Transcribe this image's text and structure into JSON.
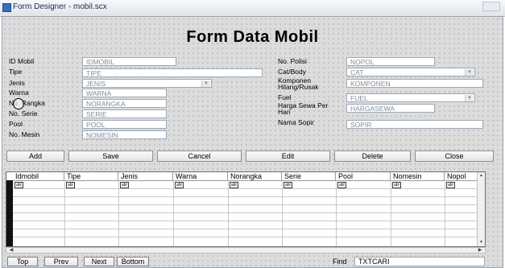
{
  "window": {
    "title": "Form Designer - mobil.scx"
  },
  "heading": "Form Data Mobil",
  "left_fields": [
    {
      "label": "ID Mobil",
      "value": "IDMOBIL",
      "kind": "text"
    },
    {
      "label": "Tipe",
      "value": "TIPE",
      "kind": "text"
    },
    {
      "label": "Jenis",
      "value": "JENIS",
      "kind": "combo"
    },
    {
      "label": "Warna",
      "value": "WARNA",
      "kind": "text"
    },
    {
      "label": "No. Rangka",
      "value": "NORANGKA",
      "kind": "text"
    },
    {
      "label": "No. Serie",
      "value": "SERIE",
      "kind": "text"
    },
    {
      "label": "Pool",
      "value": "POOL",
      "kind": "text"
    },
    {
      "label": "No. Mesin",
      "value": "NOMESIN",
      "kind": "text"
    }
  ],
  "right_fields": [
    {
      "label": "No. Polisi",
      "value": "NOPOL",
      "kind": "text"
    },
    {
      "label": "Cat/Body",
      "value": "CAT",
      "kind": "combo"
    },
    {
      "label": "Komponen Hilang/Rusak",
      "value": "KOMPONEN",
      "kind": "text"
    },
    {
      "label": "Fuel",
      "value": "FUEL",
      "kind": "combo"
    },
    {
      "label": "Harga Sewa Per Hari",
      "value": "HARGASEWA",
      "kind": "text"
    },
    {
      "label": "Nama Sopir",
      "value": "SOPIR",
      "kind": "text"
    }
  ],
  "buttons": [
    "Add",
    "Save",
    "Cancel",
    "Edit",
    "Delete",
    "Close"
  ],
  "grid": {
    "columns": [
      "Idmobil",
      "Tipe",
      "Jenis",
      "Warna",
      "Norangka",
      "Serie",
      "Pool",
      "Nomesin",
      "Nopol"
    ],
    "cell_control": "abl"
  },
  "nav_buttons": [
    "Top",
    "Prev",
    "Next",
    "Bottom"
  ],
  "find": {
    "label": "Find",
    "value": "TXTCARI"
  }
}
